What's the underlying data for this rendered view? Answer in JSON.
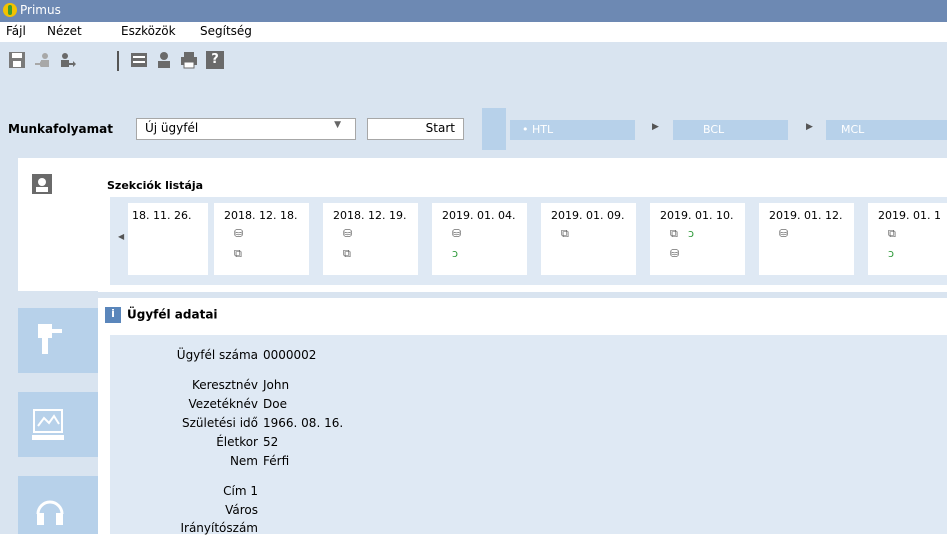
{
  "window": {
    "title": "Primus",
    "accent": "#6d89b3",
    "panel_bg": "#d9e4f0"
  },
  "menu": {
    "items": [
      "Fájl",
      "Nézet",
      "Eszközök",
      "Segítség"
    ]
  },
  "toolbar": {
    "icons": [
      "save-icon",
      "export-user-icon",
      "import-user-icon",
      "settings-panel-icon",
      "user-icon",
      "print-icon",
      "help-icon"
    ],
    "help_label": "?"
  },
  "workflow": {
    "label": "Munkafolyamat",
    "selected": "Új ügyfél",
    "start_label": "Start",
    "steps": [
      "• HTL",
      "BCL",
      "MCL"
    ]
  },
  "sessions": {
    "title": "Szekciók listája",
    "dates": [
      "18. 11. 26.",
      "2018. 12. 18.",
      "2018. 12. 19.",
      "2019. 01. 04.",
      "2019. 01. 09.",
      "2019. 01. 10.",
      "2019. 01. 12.",
      "2019. 01. 1"
    ]
  },
  "client": {
    "header": "Ügyfél adatai",
    "fields": [
      {
        "label": "Ügyfél száma",
        "value": "0000002"
      },
      {
        "label": "Keresztnév",
        "value": "John"
      },
      {
        "label": "Vezetéknév",
        "value": "Doe"
      },
      {
        "label": "Születési idő",
        "value": "1966. 08. 16."
      },
      {
        "label": "Életkor",
        "value": "52"
      },
      {
        "label": "Nem",
        "value": "Férfi"
      },
      {
        "label": "Cím 1",
        "value": ""
      },
      {
        "label": "Város",
        "value": ""
      },
      {
        "label": "Irányítószám",
        "value": ""
      }
    ]
  }
}
